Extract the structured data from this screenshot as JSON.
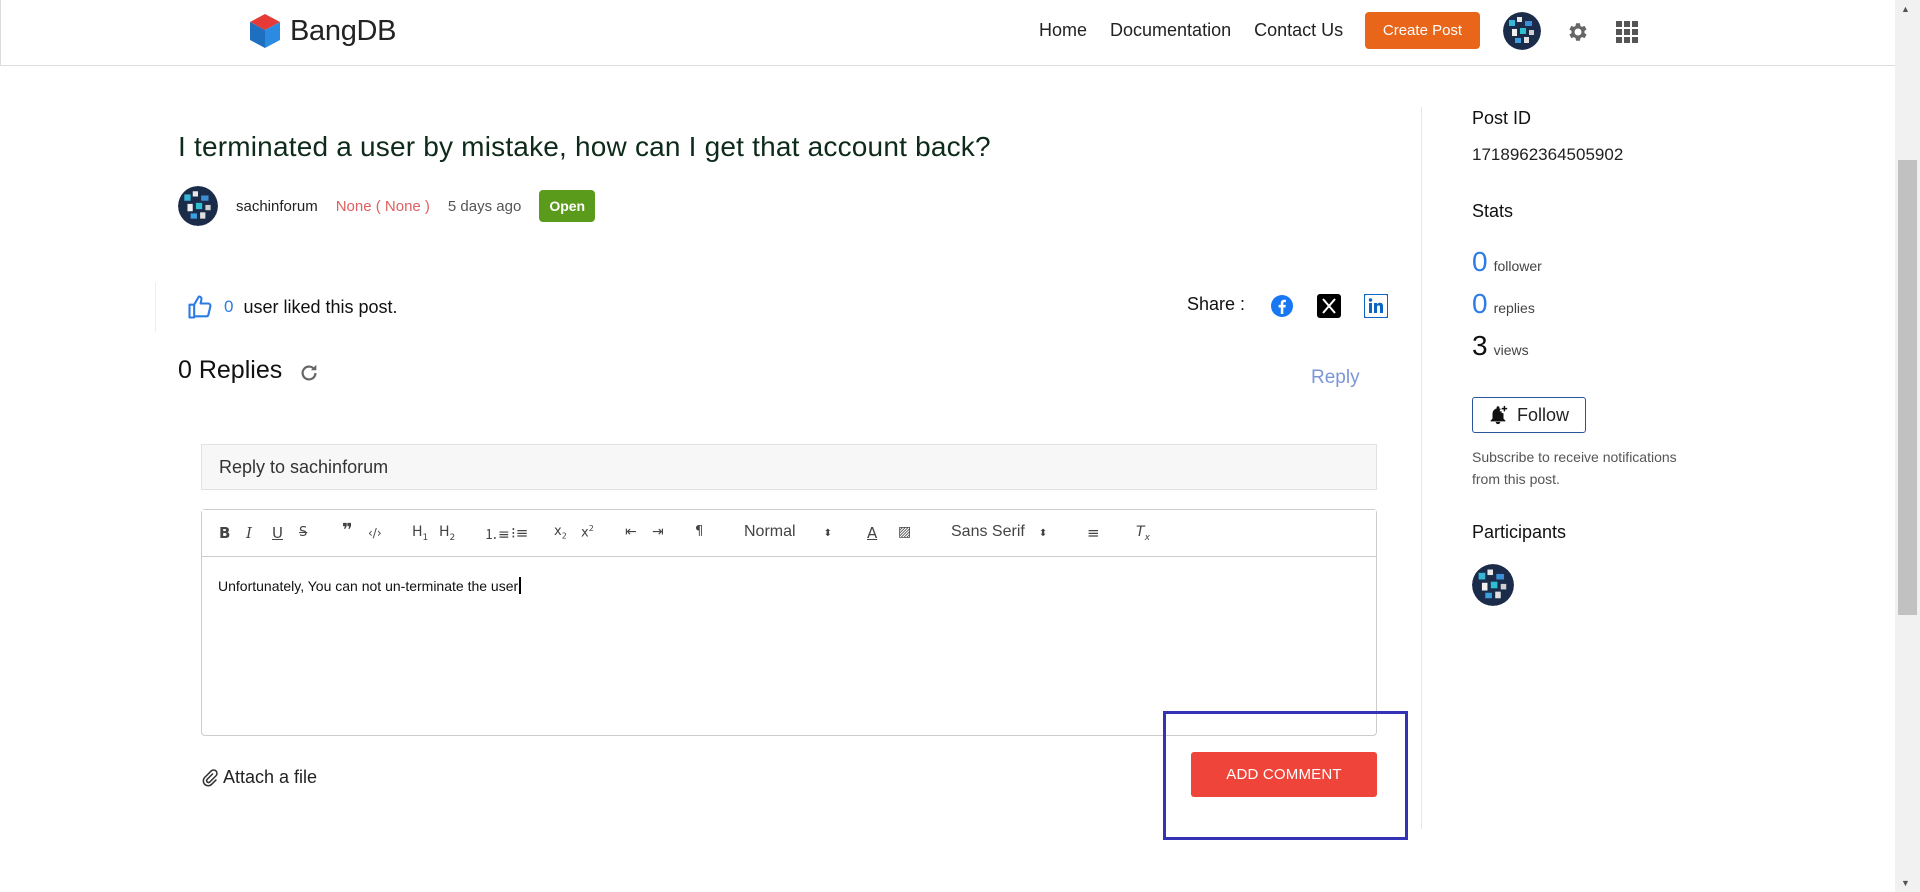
{
  "nav": {
    "brand": "BangDB",
    "links": [
      "Home",
      "Documentation",
      "Contact Us"
    ],
    "create_post": "Create Post"
  },
  "post": {
    "title": "I terminated a user by mistake, how can I get that account back?",
    "author": "sachinforum",
    "role": "None ( None )",
    "time": "5 days ago",
    "status": "Open"
  },
  "likes": {
    "count": "0",
    "text": "user liked this post."
  },
  "share": {
    "label": "Share :",
    "icons": [
      "facebook-icon",
      "x-twitter-icon",
      "linkedin-icon"
    ]
  },
  "replies": {
    "heading": "0 Replies",
    "reply_link": "Reply"
  },
  "reply_form": {
    "reply_to": "Reply to sachinforum",
    "header_select": "Normal",
    "font_select": "Sans Serif",
    "body_text": "Unfortunately, You can not un-terminate the user",
    "attach": "Attach a file",
    "submit": "ADD COMMENT"
  },
  "sidebar": {
    "post_id_label": "Post ID",
    "post_id": "1718962364505902",
    "stats_label": "Stats",
    "stats": [
      {
        "value": "0",
        "label": "follower"
      },
      {
        "value": "0",
        "label": "replies"
      },
      {
        "value": "3",
        "label": "views"
      }
    ],
    "follow": "Follow",
    "subscribe_note": "Subscribe to receive notifications from this post.",
    "participants_label": "Participants"
  },
  "colors": {
    "accent_orange": "#e8651a",
    "add_comment_red": "#ee4439",
    "open_green": "#5b9b1c",
    "link_blue": "#2d7be5",
    "highlight_box": "#3433b5"
  }
}
